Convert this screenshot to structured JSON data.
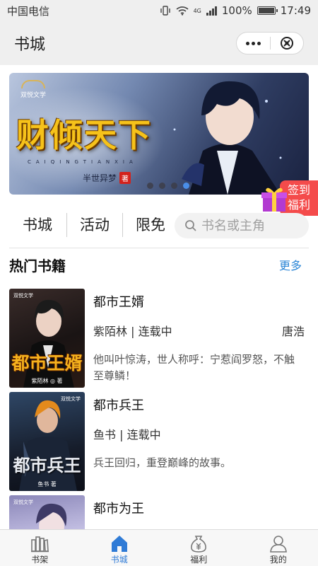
{
  "status_bar": {
    "carrier": "中国电信",
    "network": "4G",
    "battery": "100%",
    "time": "17:49"
  },
  "header": {
    "title": "书城"
  },
  "banner": {
    "publisher": "双悦文学",
    "title": "财倾天下",
    "pinyin": "CAIQINGTIANXIA",
    "author": "半世异梦",
    "seal": "著",
    "slide_count": 4,
    "active_slide": 4
  },
  "sign_badge": {
    "line1": "签到",
    "line2": "福利"
  },
  "nav": {
    "items": [
      "书城",
      "活动",
      "限免"
    ]
  },
  "search": {
    "placeholder": "书名或主角"
  },
  "section": {
    "title": "热门书籍",
    "more": "更多"
  },
  "books": [
    {
      "name": "都市王婿",
      "meta": "紫陌林 | 连载中",
      "extra": "唐浩",
      "desc": "他叫叶惊涛，世人称呼：宁惹阎罗怒，不触至尊鳞！",
      "cover_title": "都市王婿",
      "cover_author": "紫陌林 ◎ 著",
      "cover_publisher": "双悦文学"
    },
    {
      "name": "都市兵王",
      "meta": "鱼书 | 连载中",
      "extra": "",
      "desc": "兵王回归，重登巅峰的故事。",
      "cover_title": "都市兵王",
      "cover_author": "鱼书 著",
      "cover_publisher": "双悦文学"
    },
    {
      "name": "都市为王",
      "meta": "",
      "extra": "",
      "desc": "",
      "cover_title": "",
      "cover_author": "",
      "cover_publisher": "双悦文学"
    }
  ],
  "tabbar": {
    "items": [
      {
        "label": "书架",
        "icon": "bookshelf-icon"
      },
      {
        "label": "书城",
        "icon": "home-icon",
        "active": true
      },
      {
        "label": "福利",
        "icon": "money-bag-icon"
      },
      {
        "label": "我的",
        "icon": "user-icon"
      }
    ]
  },
  "colors": {
    "accent": "#2f7bd6",
    "more_link": "#2c86d6",
    "sign_badge": "#f44b4b",
    "banner_title": "#f6c21a"
  }
}
